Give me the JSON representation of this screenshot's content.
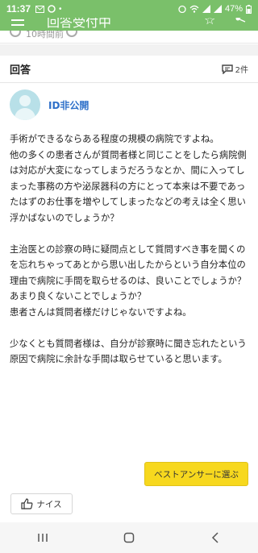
{
  "status_bar": {
    "time": "11:37",
    "battery": "47%"
  },
  "app_bar": {
    "title": "回答受付中"
  },
  "meta": {
    "text": "10時間前"
  },
  "answer_section": {
    "heading": "回答",
    "count": "2件"
  },
  "answer": {
    "user": "ID非公開",
    "body": "手術ができるならある程度の規模の病院ですよね。\n他の多くの患者さんが質問者様と同じことをしたら病院側は対応が大変になってしまうだろうなとか、間に入ってしまった事務の方や泌尿器科の方にとって本来は不要であったはずのお仕事を増やしてしまったなどの考えは全く思い浮かばないのでしょうか？\n\n主治医との診察の時に疑問点として質問すべき事を聞くのを忘れちゃってあとから思い出したからという自分本位の理由で病院に手間を取らせるのは、良いことでしょうか？あまり良くないことでしょうか？\n患者さんは質問者様だけじゃないですよね。\n\n少なくとも質問者様は、自分が診察時に聞き忘れたという原因で病院に余計な手間は取らせていると思います。"
  },
  "actions": {
    "best_answer": "ベストアンサーに選ぶ",
    "nice": "ナイス"
  }
}
